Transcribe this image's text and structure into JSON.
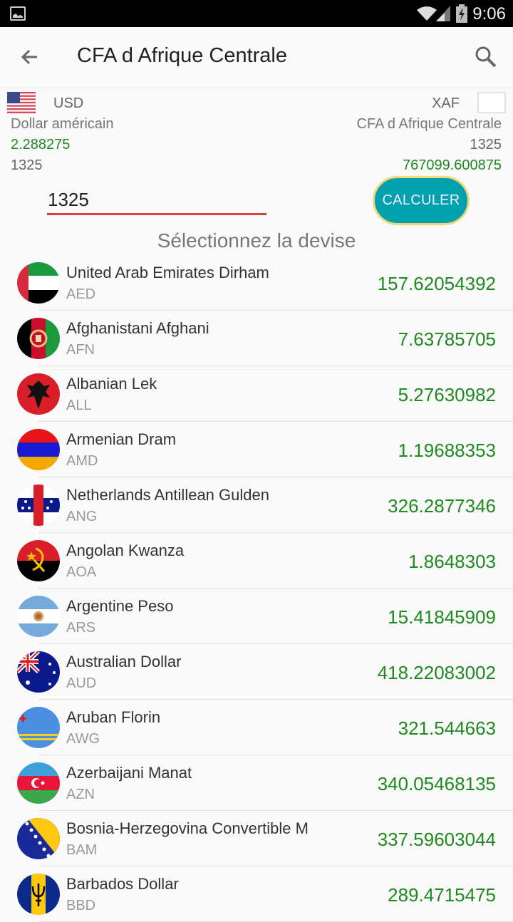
{
  "status_bar": {
    "time": "9:06",
    "icons": [
      "gallery-icon",
      "wifi-icon",
      "signal-icon",
      "battery-charging-icon"
    ]
  },
  "app_bar": {
    "title": "CFA d Afrique Centrale",
    "back_icon": "arrow-left-icon",
    "search_icon": "search-icon"
  },
  "conversion": {
    "from": {
      "code": "USD",
      "name": "Dollar américain",
      "rate": "2.288275",
      "amount": "1325"
    },
    "to": {
      "code": "XAF",
      "name": "CFA d Afrique Centrale",
      "amount": "1325",
      "result": "767099.600875"
    },
    "input_value": "1325",
    "calculate_label": "CALCULER"
  },
  "section_title": "Sélectionnez la devise",
  "colors": {
    "accent_green": "#1f8a1f",
    "button_teal": "#00a1ad",
    "button_border": "#f2d77a",
    "input_underline": "#d5453f"
  },
  "currencies": [
    {
      "name": "United Arab Emirates Dirham",
      "code": "AED",
      "value": "157.62054392",
      "flag": "uae-flag-icon"
    },
    {
      "name": "Afghanistani Afghani",
      "code": "AFN",
      "value": "7.63785705",
      "flag": "afghanistan-flag-icon"
    },
    {
      "name": "Albanian Lek",
      "code": "ALL",
      "value": "5.27630982",
      "flag": "albania-flag-icon"
    },
    {
      "name": "Armenian Dram",
      "code": "AMD",
      "value": "1.19688353",
      "flag": "armenia-flag-icon"
    },
    {
      "name": "Netherlands Antillean Gulden",
      "code": "ANG",
      "value": "326.2877346",
      "flag": "netherlands-antilles-flag-icon"
    },
    {
      "name": "Angolan Kwanza",
      "code": "AOA",
      "value": "1.8648303",
      "flag": "angola-flag-icon"
    },
    {
      "name": "Argentine Peso",
      "code": "ARS",
      "value": "15.41845909",
      "flag": "argentina-flag-icon"
    },
    {
      "name": "Australian Dollar",
      "code": "AUD",
      "value": "418.22083002",
      "flag": "australia-flag-icon"
    },
    {
      "name": "Aruban Florin",
      "code": "AWG",
      "value": "321.544663",
      "flag": "aruba-flag-icon"
    },
    {
      "name": "Azerbaijani Manat",
      "code": "AZN",
      "value": "340.05468135",
      "flag": "azerbaijan-flag-icon"
    },
    {
      "name": "Bosnia-Herzegovina Convertible M",
      "code": "BAM",
      "value": "337.59603044",
      "flag": "bosnia-flag-icon"
    },
    {
      "name": "Barbados Dollar",
      "code": "BBD",
      "value": "289.4715475",
      "flag": "barbados-flag-icon"
    }
  ]
}
